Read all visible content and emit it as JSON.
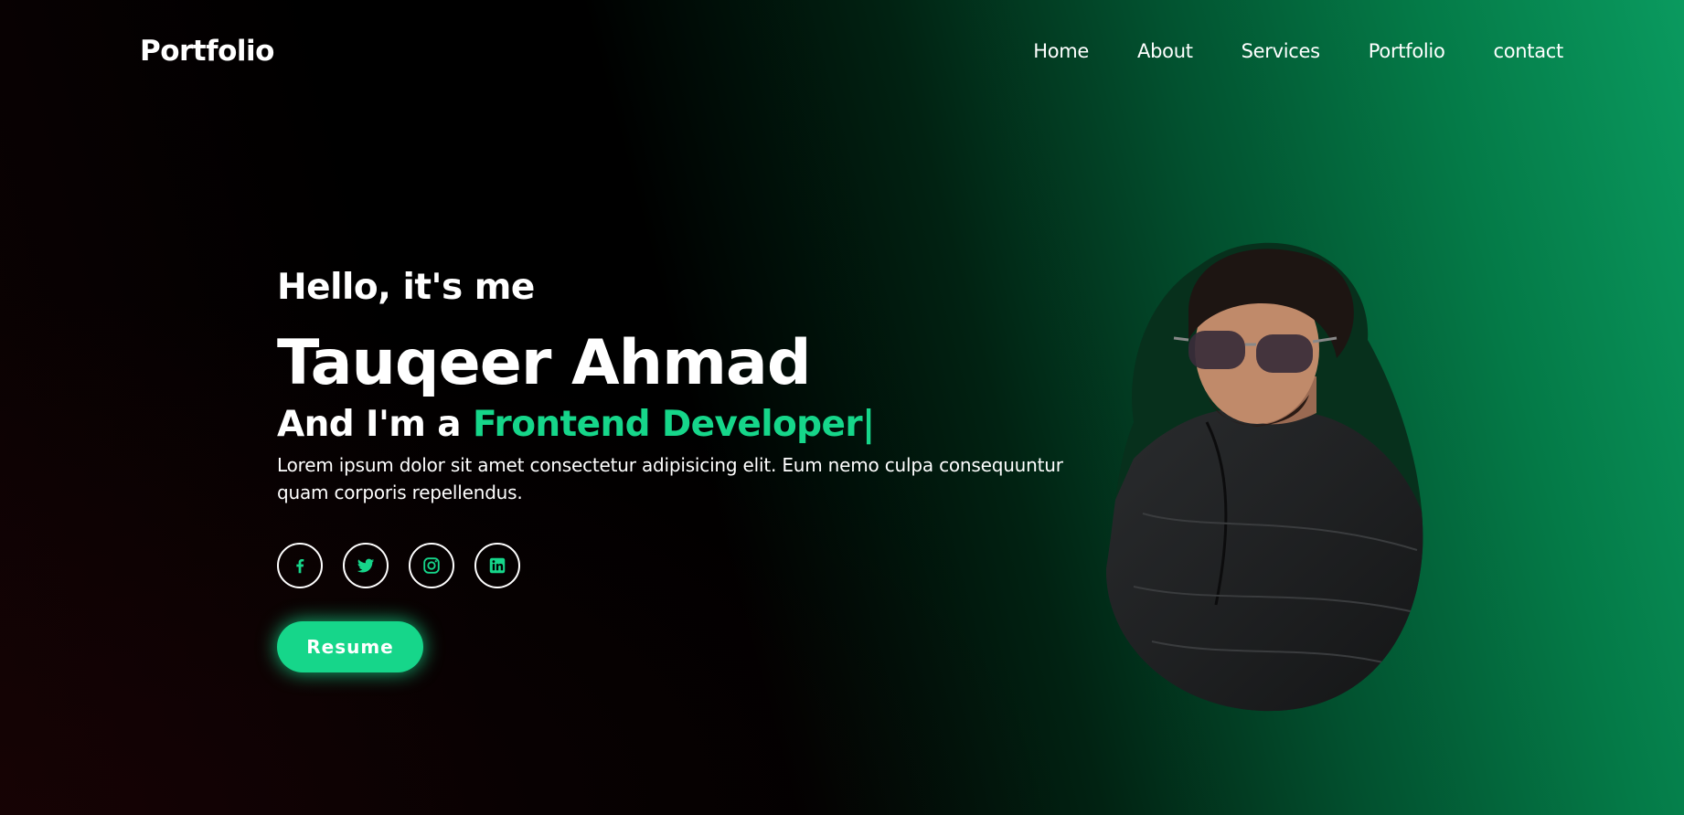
{
  "header": {
    "logo": "Portfolio",
    "nav": [
      "Home",
      "About",
      "Services",
      "Portfolio",
      "contact"
    ]
  },
  "hero": {
    "greeting": "Hello, it's me",
    "name": "Tauqeer Ahmad",
    "role_prefix": "And I'm a",
    "role_highlight": "Frontend Developer|",
    "bio": "Lorem ipsum dolor sit amet consectetur adipisicing elit. Eum nemo culpa consequuntur quam corporis repellendus.",
    "socials": [
      "facebook-icon",
      "twitter-icon",
      "instagram-icon",
      "linkedin-icon"
    ],
    "resume_label": "Resume"
  },
  "colors": {
    "accent": "#16d68a",
    "background_dark": "#000000",
    "background_green": "#0a9a5f"
  }
}
